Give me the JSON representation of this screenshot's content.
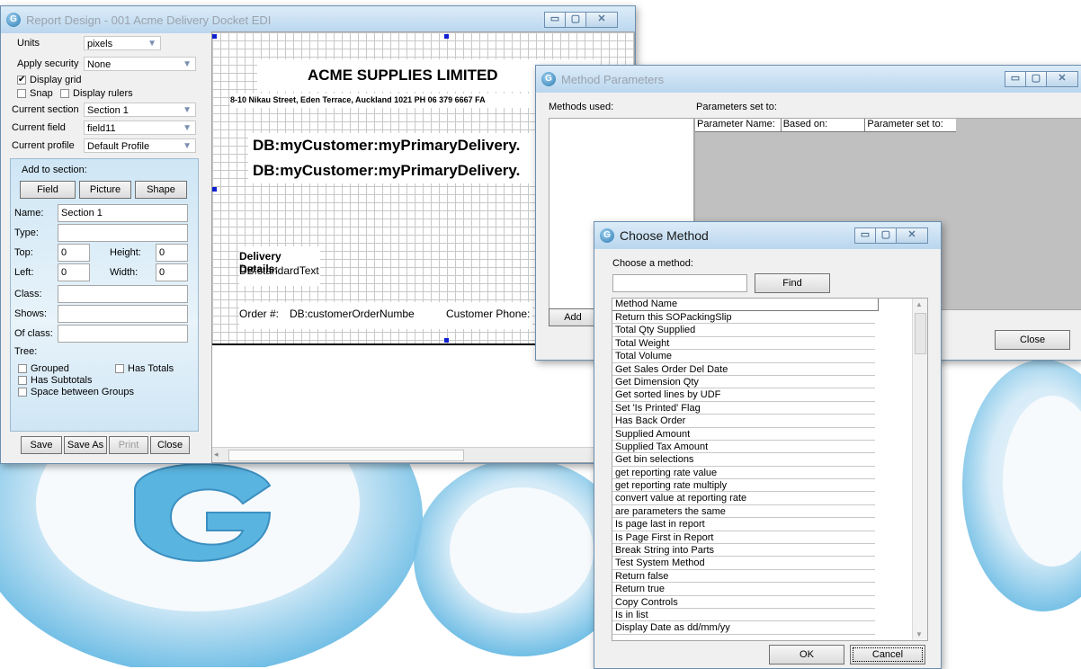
{
  "report_window": {
    "title": "Report Design - 001 Acme Delivery Docket EDI",
    "units_label": "Units",
    "units_value": "pixels",
    "apply_security_label": "Apply security",
    "apply_security_value": "None",
    "display_grid_label": "Display grid",
    "display_grid_checked": "✔",
    "snap_label": "Snap",
    "display_rulers_label": "Display rulers",
    "current_section_label": "Current section",
    "current_section_value": "Section 1",
    "current_field_label": "Current field",
    "current_field_value": "field11",
    "current_profile_label": "Current profile",
    "current_profile_value": "Default Profile",
    "add_to_section_label": "Add to section:",
    "field_button": "Field",
    "picture_button": "Picture",
    "shape_button": "Shape",
    "name_label": "Name:",
    "name_value": "Section 1",
    "type_label": "Type:",
    "top_label": "Top:",
    "top_value": "0",
    "height_label": "Height:",
    "height_value": "0",
    "left_label": "Left:",
    "left_value": "0",
    "width_label": "Width:",
    "width_value": "0",
    "class_label": "Class:",
    "shows_label": "Shows:",
    "of_class_label": "Of class:",
    "tree_label": "Tree:",
    "grouped_label": "Grouped",
    "has_totals_label": "Has Totals",
    "has_subtotals_label": "Has Subtotals",
    "space_between_groups_label": "Space between Groups",
    "save_button": "Save",
    "save_as_button": "Save As",
    "print_button": "Print",
    "close_button": "Close",
    "canvas": {
      "company": "ACME SUPPLIES LIMITED",
      "address": "8-10 Nikau Street, Eden Terrace, Auckland 1021 PH 06 379 6667 FA",
      "db_line_1": "DB:myCustomer:myPrimaryDelivery.",
      "db_line_2": "DB:myCustomer:myPrimaryDelivery.",
      "delivery_details": "Delivery Details:",
      "standard_text": "DB:standardText",
      "order_label": "Order #:",
      "order_field": "DB:customerOrderNumbe",
      "customer_phone": "Customer Phone:"
    }
  },
  "method_params_window": {
    "title": "Method Parameters",
    "methods_used_label": "Methods used:",
    "parameters_set_to_label": "Parameters set to:",
    "columns": [
      "Parameter Name:",
      "Based on:",
      "Parameter set to:"
    ],
    "add_button": "Add",
    "close_button": "Close"
  },
  "choose_method_window": {
    "title": "Choose Method",
    "choose_label": "Choose a method:",
    "search_value": "",
    "find_button": "Find",
    "column_header": "Method Name",
    "methods": [
      "Return this SOPackingSlip",
      "Total Qty Supplied",
      "Total Weight",
      "Total Volume",
      "Get Sales Order Del Date",
      "Get Dimension Qty",
      "Get sorted lines by UDF",
      "Set 'Is Printed' Flag",
      "Has Back Order",
      "Supplied Amount",
      "Supplied Tax Amount",
      "Get bin selections",
      "get reporting rate value",
      "get reporting rate multiply",
      "convert value at reporting rate",
      "are parameters the same",
      "Is page last in report",
      "Is Page First in Report",
      "Break String into Parts",
      "Test System Method",
      "Return false",
      "Return true",
      "Copy Controls",
      "Is in list",
      "Display Date as dd/mm/yy"
    ],
    "ok_button": "OK",
    "cancel_button": "Cancel"
  },
  "window_controls": {
    "minimize": "▭",
    "maximize": "▢",
    "close": "✕"
  },
  "app_icon_letter": "G",
  "colors": {
    "titlebar": "#c4dcf0",
    "panel": "#dceef9",
    "logo": "#5ab4e0"
  }
}
